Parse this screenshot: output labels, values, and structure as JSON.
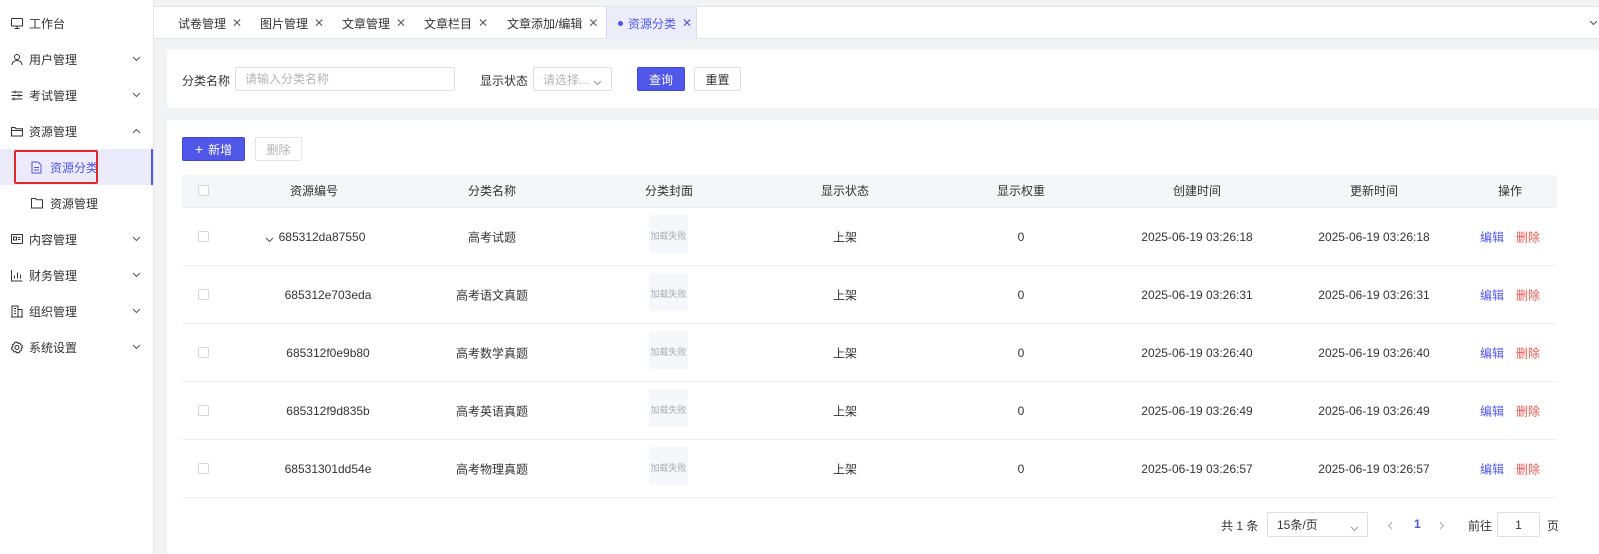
{
  "sidebar": {
    "items": [
      {
        "label": "工作台",
        "icon": "monitor-icon"
      },
      {
        "label": "用户管理",
        "icon": "user-icon"
      },
      {
        "label": "考试管理",
        "icon": "sliders-icon"
      },
      {
        "label": "资源管理",
        "icon": "folder-open-icon"
      },
      {
        "label": "资源分类",
        "icon": "document-icon"
      },
      {
        "label": "资源管理",
        "icon": "folder-icon"
      },
      {
        "label": "内容管理",
        "icon": "id-card-icon"
      },
      {
        "label": "财务管理",
        "icon": "bar-chart-icon"
      },
      {
        "label": "组织管理",
        "icon": "building-icon"
      },
      {
        "label": "系统设置",
        "icon": "gear-icon"
      }
    ]
  },
  "tabs": [
    {
      "label": "试卷管理"
    },
    {
      "label": "图片管理"
    },
    {
      "label": "文章管理"
    },
    {
      "label": "文章栏目"
    },
    {
      "label": "文章添加/编辑"
    },
    {
      "label": "资源分类"
    }
  ],
  "search": {
    "name_label": "分类名称",
    "name_placeholder": "请输入分类名称",
    "status_label": "显示状态",
    "status_placeholder": "请选择...",
    "query_label": "查询",
    "reset_label": "重置"
  },
  "toolbar": {
    "add_label": "新增",
    "delete_label": "删除"
  },
  "table": {
    "columns": [
      "资源编号",
      "分类名称",
      "分类封面",
      "显示状态",
      "显示权重",
      "创建时间",
      "更新时间",
      "操作"
    ],
    "cover_text": "加载失败",
    "edit_label": "编辑",
    "delete_label": "删除",
    "rows": [
      {
        "id": "685312da87550",
        "name": "高考试题",
        "status": "上架",
        "weight": "0",
        "created": "2025-06-19 03:26:18",
        "updated": "2025-06-19 03:26:18"
      },
      {
        "id": "685312e703eda",
        "name": "高考语文真题",
        "status": "上架",
        "weight": "0",
        "created": "2025-06-19 03:26:31",
        "updated": "2025-06-19 03:26:31"
      },
      {
        "id": "685312f0e9b80",
        "name": "高考数学真题",
        "status": "上架",
        "weight": "0",
        "created": "2025-06-19 03:26:40",
        "updated": "2025-06-19 03:26:40"
      },
      {
        "id": "685312f9d835b",
        "name": "高考英语真题",
        "status": "上架",
        "weight": "0",
        "created": "2025-06-19 03:26:49",
        "updated": "2025-06-19 03:26:49"
      },
      {
        "id": "68531301dd54e",
        "name": "高考物理真题",
        "status": "上架",
        "weight": "0",
        "created": "2025-06-19 03:26:57",
        "updated": "2025-06-19 03:26:57"
      }
    ]
  },
  "pagination": {
    "total_text": "共 1 条",
    "page_size": "15条/页",
    "current_page": "1",
    "goto_label": "前往",
    "goto_value": "1",
    "page_suffix": "页"
  },
  "colors": {
    "primary": "#4f56e8",
    "danger": "#e9574f",
    "highlight": "#e0262b"
  }
}
